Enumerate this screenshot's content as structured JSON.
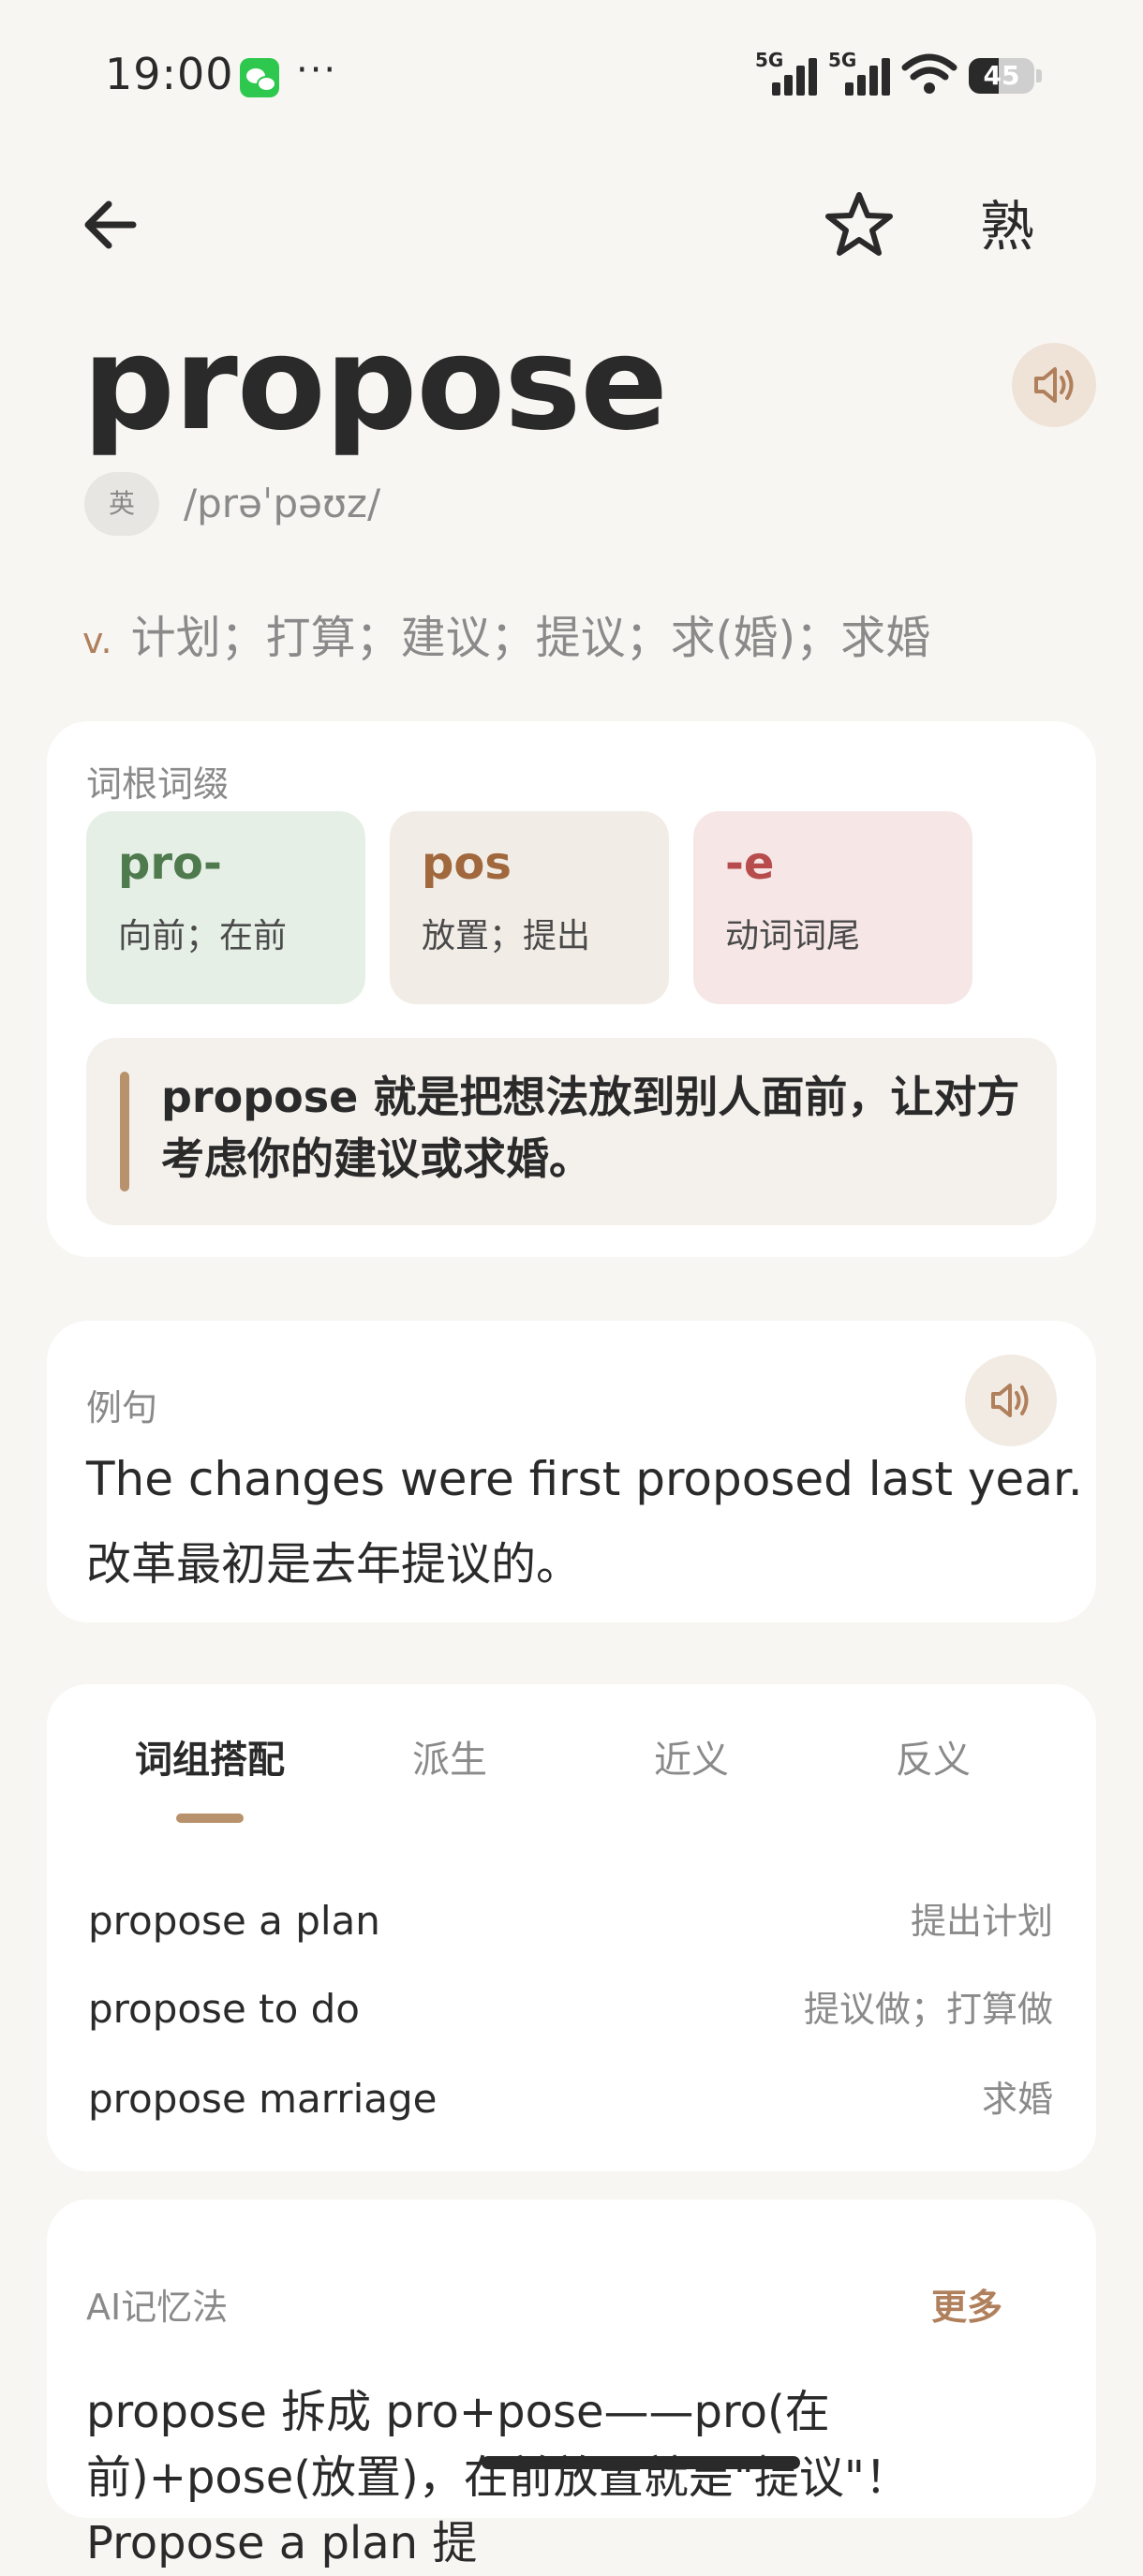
{
  "status_bar": {
    "time": "19:00",
    "app_icon": "wechat-icon",
    "more": "···",
    "signal_labels": [
      "5G",
      "5G"
    ],
    "battery": "45",
    "battery_level": 0.45
  },
  "nav": {
    "back_icon": "arrow-left-icon",
    "star_icon": "star-outline-icon",
    "familiar_label": "熟"
  },
  "word": {
    "text": "propose",
    "accent_label": "英",
    "phonetic": "/prəˈpəʊz/",
    "speaker_icon": "speaker-icon",
    "pos": "v.",
    "meaning": "计划；打算；建议；提议；求(婚)；求婚"
  },
  "etymology": {
    "label": "词根词缀",
    "parts": [
      {
        "part": "pro-",
        "meaning": "向前；在前",
        "color": "#4e7a4e",
        "bg": "#e6efe6"
      },
      {
        "part": "pos",
        "meaning": "放置；提出",
        "color": "#a0683c",
        "bg": "#f2ece6"
      },
      {
        "part": "-e",
        "meaning": "动词词尾",
        "color": "#b84c4c",
        "bg": "#f6e6e6"
      }
    ],
    "story": "propose 就是把想法放到别人面前，让对方考虑你的建议或求婚。"
  },
  "example": {
    "label": "例句",
    "en": "The changes were first proposed last year.",
    "cn": "改革最初是去年提议的。"
  },
  "tabs": [
    "词组搭配",
    "派生",
    "近义",
    "反义"
  ],
  "active_tab": 0,
  "phrases": [
    {
      "en": "propose a plan",
      "cn": "提出计划"
    },
    {
      "en": "propose to do",
      "cn": "提议做；打算做"
    },
    {
      "en": "propose marriage",
      "cn": "求婚"
    }
  ],
  "ai_memory": {
    "label": "AI记忆法",
    "more": "更多",
    "text": "propose 拆成 pro+pose——pro(在前)+pose(放置)，在前放置就是\"提议\"！Propose a plan 提"
  },
  "colors": {
    "background": "#f8f6f3",
    "accent": "#b0805c"
  }
}
